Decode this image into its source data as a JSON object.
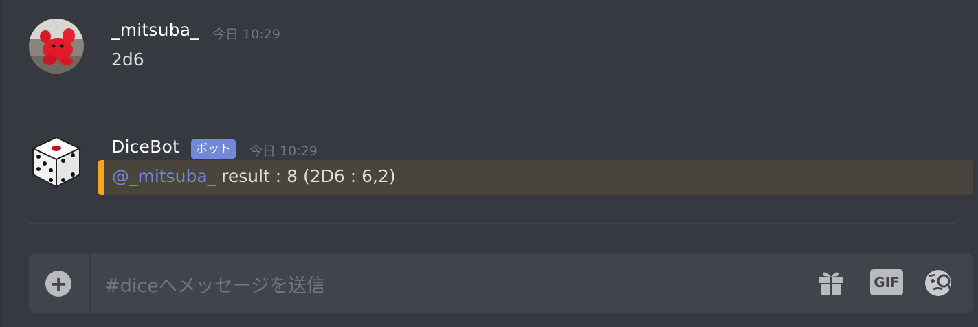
{
  "messages": [
    {
      "username": "_mitsuba_",
      "timestamp": "今日 10:29",
      "content": "2d6",
      "avatar": "red-stuffed-toy-avatar"
    },
    {
      "username": "DiceBot",
      "bot_tag": "ボット",
      "timestamp": "今日 10:29",
      "mention": "@_mitsuba_",
      "content": " result : 8 (2D6 : 6,2)",
      "avatar": "dice-avatar"
    }
  ],
  "input": {
    "placeholder": "#diceへメッセージを送信",
    "gif_label": "GIF",
    "icons": [
      "plus-circle-icon",
      "gift-icon",
      "gif-icon",
      "emoji-icon"
    ]
  },
  "colors": {
    "background": "#36393f",
    "input_background": "#40444b",
    "mention": "#7289da",
    "highlight_bar": "#faa61a",
    "highlight_background": "#49443c",
    "bot_tag": "#7289da"
  }
}
